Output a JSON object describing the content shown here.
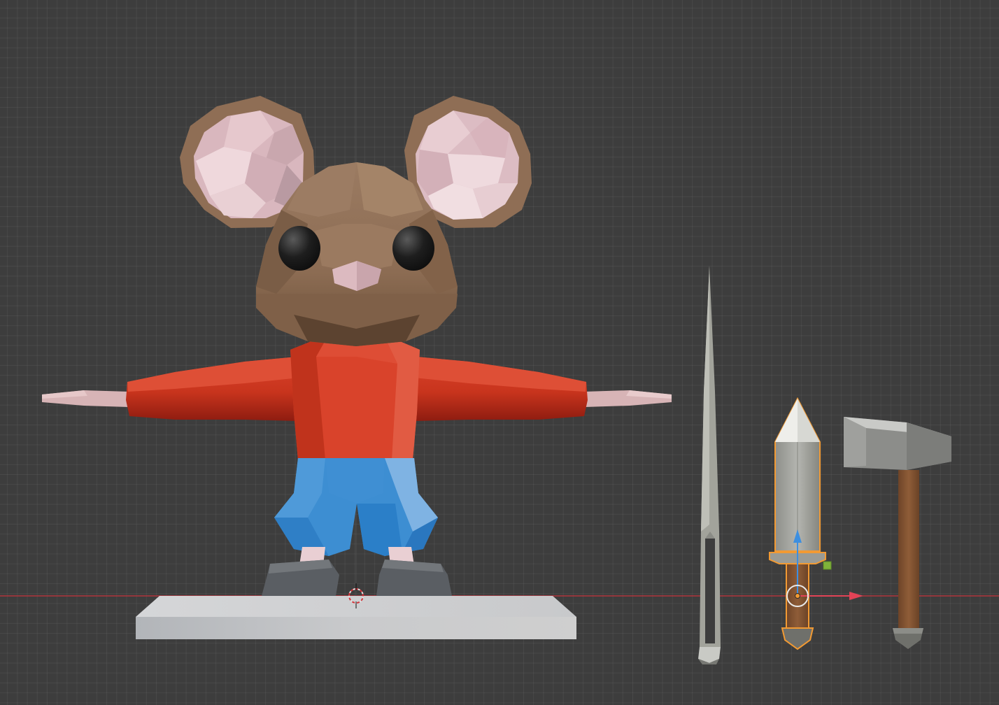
{
  "viewport": {
    "mode": "3D Viewport",
    "grid": true,
    "x_axis_color": "#c8323c",
    "selection_outline_color": "#f29a33"
  },
  "scene_objects": [
    {
      "name": "mouse-character",
      "selected": false
    },
    {
      "name": "stand-base",
      "selected": false
    },
    {
      "name": "needle",
      "selected": false
    },
    {
      "name": "dagger",
      "selected": true,
      "active": true
    },
    {
      "name": "hammer",
      "selected": false
    }
  ],
  "gizmo": {
    "z_arrow_color": "#3d8fe0",
    "x_arrow_color": "#e24356",
    "pivot_color": "#f29a33",
    "handle_color": "#7fb33a"
  },
  "colors": {
    "fur": "#8f6e55",
    "ear_inner": "#e2bfc6",
    "shirt": "#d9432b",
    "shorts": "#3d8ed2",
    "shoes": "#5c5f63",
    "base": "#d2d3d5",
    "blade": "#a7a8a2",
    "handle_wood": "#8a5a35"
  }
}
